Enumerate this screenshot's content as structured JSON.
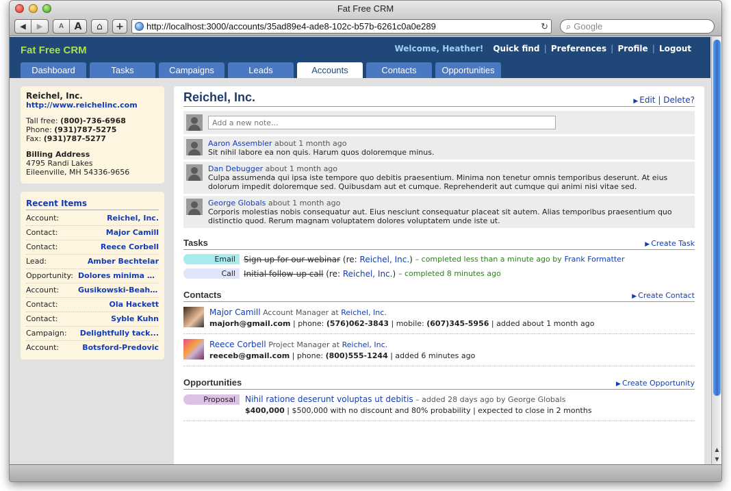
{
  "window": {
    "title": "Fat Free CRM"
  },
  "browser": {
    "url": "http://localhost:3000/accounts/35ad89e4-ade8-102c-b57b-6261c0a0e289",
    "search_placeholder": "Google",
    "back_icon": "◀",
    "forward_icon": "▶",
    "text_small": "A",
    "text_large": "A",
    "home_icon": "⌂",
    "add_icon": "+",
    "reload_icon": "↻",
    "search_icon": "⌕"
  },
  "app": {
    "brand": "Fat Free CRM",
    "welcome": "Welcome, Heather!",
    "user_links": [
      "Quick find",
      "Preferences",
      "Profile",
      "Logout"
    ],
    "tabs": [
      "Dashboard",
      "Tasks",
      "Campaigns",
      "Leads",
      "Accounts",
      "Contacts",
      "Opportunities"
    ],
    "active_tab": "Accounts"
  },
  "sidebar": {
    "account_name": "Reichel, Inc.",
    "website": "http://www.reichelinc.com",
    "toll_free_label": "Tall free:",
    "toll_free": "(800)-736-6968",
    "phone_label": "Phone:",
    "phone": "(931)787-5275",
    "fax_label": "Fax:",
    "fax": "(931)787-5277",
    "billing_label": "Billing Address",
    "address1": "4795 Randi Lakes",
    "address2": "Eileenville, MH 54336-9656",
    "recent_title": "Recent Items",
    "recent": [
      {
        "type": "Account:",
        "name": "Reichel, Inc."
      },
      {
        "type": "Contact:",
        "name": "Major Camill"
      },
      {
        "type": "Contact:",
        "name": "Reece Corbell"
      },
      {
        "type": "Lead:",
        "name": "Amber Bechtelar"
      },
      {
        "type": "Opportunity:",
        "name": "Dolores minima se..."
      },
      {
        "type": "Account:",
        "name": "Gusikowski-Beahan"
      },
      {
        "type": "Contact:",
        "name": "Ola Hackett"
      },
      {
        "type": "Contact:",
        "name": "Syble Kuhn"
      },
      {
        "type": "Campaign:",
        "name": "Delightfully tack..."
      },
      {
        "type": "Account:",
        "name": "Botsford-Predovic"
      }
    ]
  },
  "main": {
    "title": "Reichel, Inc.",
    "edit": "Edit",
    "delete": "Delete?",
    "note_placeholder": "Add a new note...",
    "comments": [
      {
        "author": "Aaron Assembler",
        "time": "about 1 month ago",
        "text": "Sit nihil labore ea non quis. Harum quos doloremque minus."
      },
      {
        "author": "Dan Debugger",
        "time": "about 1 month ago",
        "text": "Culpa assumenda qui ipsa iste tempore quo debitis praesentium. Minima non tenetur omnis temporibus deserunt. At eius dolorum impedit doloremque sed. Quibusdam aut et cumque. Reprehenderit aut cumque qui animi nisi vitae sed."
      },
      {
        "author": "George Globals",
        "time": "about 1 month ago",
        "text": "Corporis molestias nobis consequatur aut. Eius nesciunt consequatur placeat sit autem. Alias temporibus praesentium quo distinctio quod. Rerum magnam voluptatem dolores voluptatem unde iste ut."
      }
    ],
    "tasks_title": "Tasks",
    "create_task": "Create Task",
    "tasks": [
      {
        "type": "Email",
        "name": "Sign up for our webinar",
        "re_prefix": "(re:",
        "re": "Reichel, Inc.",
        "re_suffix": ")",
        "status": "– completed less than a minute ago by",
        "by": "Frank Formatter"
      },
      {
        "type": "Call",
        "name": "Initial follow-up call",
        "re_prefix": "(re:",
        "re": "Reichel, Inc.",
        "re_suffix": ")",
        "status": "– completed 8 minutes ago",
        "by": ""
      }
    ],
    "contacts_title": "Contacts",
    "create_contact": "Create Contact",
    "contacts": [
      {
        "name": "Major Camill",
        "role": "Account Manager at",
        "company": "Reichel, Inc.",
        "email": "majorh@gmail.com",
        "phone_label": "| phone:",
        "phone": "(576)062-3843",
        "mobile_label": "| mobile:",
        "mobile": "(607)345-5956",
        "added": "| added about 1 month ago"
      },
      {
        "name": "Reece Corbell",
        "role": "Project Manager at",
        "company": "Reichel, Inc.",
        "email": "reeceb@gmail.com",
        "phone_label": "| phone:",
        "phone": "(800)555-1244",
        "mobile_label": "",
        "mobile": "",
        "added": "| added 6 minutes ago"
      }
    ],
    "opps_title": "Opportunities",
    "create_opp": "Create Opportunity",
    "opps": [
      {
        "stage": "Proposal",
        "name": "Nihil ratione deserunt voluptas ut debitis",
        "added": "– added 28 days ago by George Globals",
        "amount": "$400,000",
        "details": "| $500,000 with no discount and 80% probability | expected to close in 2 months"
      }
    ]
  },
  "colors": {
    "header_bg": "#1f4878",
    "brand": "#a7e04c",
    "tab": "#4a78c2",
    "link": "#123cb6",
    "sidebar_bg": "#fdf5e0",
    "email_badge": "#a7ecec",
    "call_badge": "#e1e4fb",
    "proposal_badge": "#dcc3e6"
  }
}
